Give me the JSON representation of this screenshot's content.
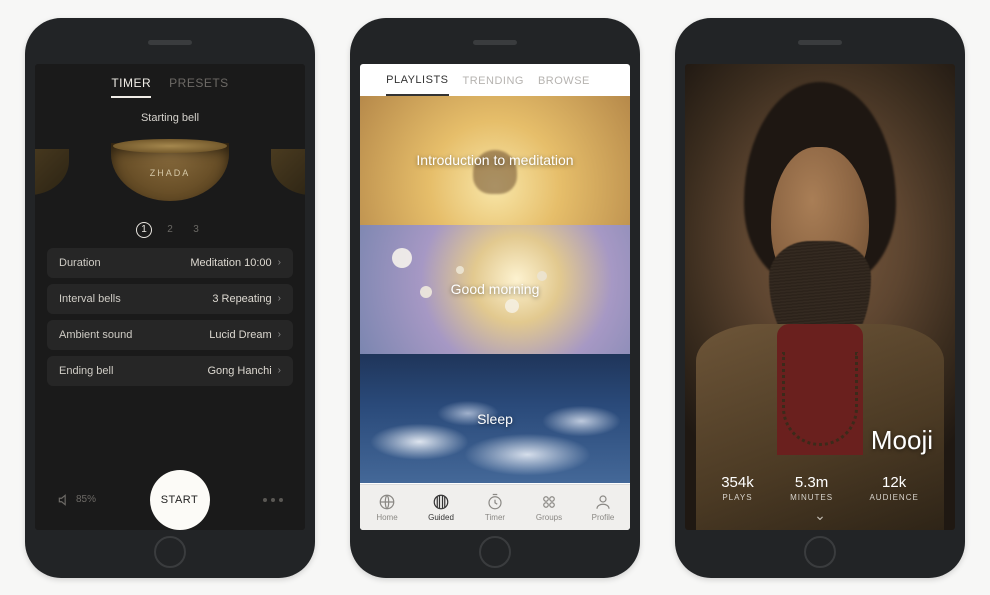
{
  "screen1": {
    "tabs": {
      "timer": "TIMER",
      "presets": "PRESETS"
    },
    "starting_bell_label": "Starting bell",
    "bowl_name": "ZHADA",
    "pager": {
      "p1": "1",
      "p2": "2",
      "p3": "3"
    },
    "rows": {
      "duration": {
        "label": "Duration",
        "value": "Meditation 10:00"
      },
      "interval": {
        "label": "Interval bells",
        "value": "3 Repeating"
      },
      "ambient": {
        "label": "Ambient sound",
        "value": "Lucid Dream"
      },
      "ending": {
        "label": "Ending bell",
        "value": "Gong Hanchi"
      }
    },
    "volume": "85%",
    "start": "START"
  },
  "screen2": {
    "tabs": {
      "playlists": "PLAYLISTS",
      "trending": "TRENDING",
      "browse": "BROWSE"
    },
    "playlists": {
      "p1": "Introduction to meditation",
      "p2": "Good morning",
      "p3": "Sleep"
    },
    "tabbar": {
      "home": "Home",
      "guided": "Guided",
      "timer": "Timer",
      "groups": "Groups",
      "profile": "Profile"
    }
  },
  "screen3": {
    "name": "Mooji",
    "stats": {
      "plays": {
        "value": "354k",
        "label": "PLAYS"
      },
      "minutes": {
        "value": "5.3m",
        "label": "MINUTES"
      },
      "audience": {
        "value": "12k",
        "label": "AUDIENCE"
      }
    }
  }
}
